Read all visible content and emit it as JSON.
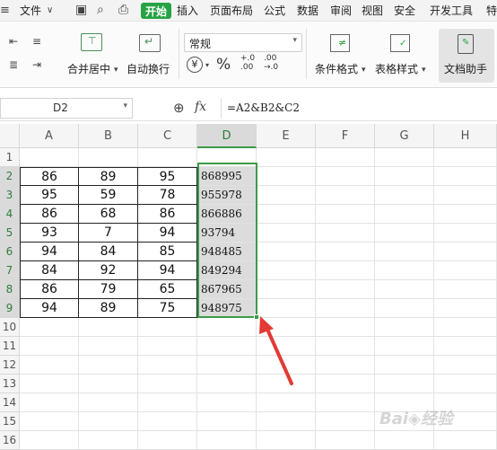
{
  "menu": {
    "file": "文件",
    "tabs": [
      "开始",
      "插入",
      "页面布局",
      "公式",
      "数据",
      "审阅",
      "视图",
      "安全",
      "开发工具",
      "特"
    ],
    "active_tab": "开始"
  },
  "ribbon": {
    "merge_center": "合并居中",
    "auto_wrap": "自动换行",
    "number_format": "常规",
    "percent": "%",
    "cond_format": "条件格式",
    "table_style": "表格样式",
    "doc_helper": "文档助手",
    "currency_symbol": "¥",
    "inc_decimal": "+.0\n.00",
    "dec_decimal": ".00\n→.0"
  },
  "formula_bar": {
    "cell_ref": "D2",
    "fx": "fx",
    "formula": "=A2&B2&C2"
  },
  "sheet": {
    "columns": [
      "A",
      "B",
      "C",
      "D",
      "E",
      "F",
      "G",
      "H"
    ],
    "rows": [
      "1",
      "2",
      "3",
      "4",
      "5",
      "6",
      "7",
      "8",
      "9",
      "10",
      "11",
      "12",
      "13",
      "14",
      "15",
      "16"
    ],
    "data": [
      [
        "86",
        "89",
        "95",
        "868995"
      ],
      [
        "95",
        "59",
        "78",
        "955978"
      ],
      [
        "86",
        "68",
        "86",
        "866886"
      ],
      [
        "93",
        "7",
        "94",
        "93794"
      ],
      [
        "94",
        "84",
        "85",
        "948485"
      ],
      [
        "84",
        "92",
        "94",
        "849294"
      ],
      [
        "86",
        "79",
        "65",
        "867965"
      ],
      [
        "94",
        "89",
        "75",
        "948975"
      ]
    ]
  },
  "colors": {
    "accent": "#27a344",
    "selection": "#3d9b46",
    "arrow": "#e23b35"
  }
}
